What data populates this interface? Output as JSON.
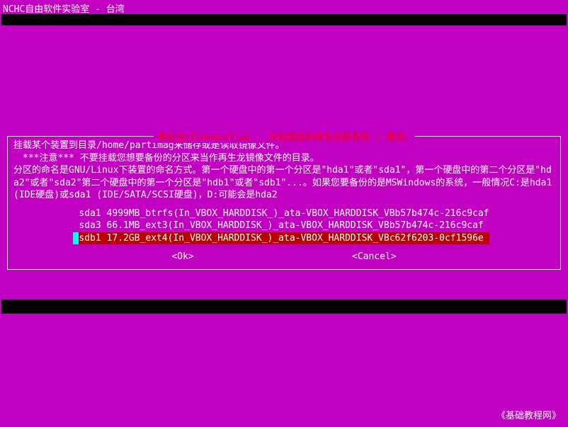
{
  "titlebar": {
    "text": "NCHC自由软件实验室 - 台湾"
  },
  "dialog": {
    "title": "再生龙(Clonezilla) - 开放原始码再生还原系统 | 模式:",
    "body": "挂载某个装置到目录/home/partimag来储存或是读取镜像文件。\n　***注意*** 不要挂载您想要备份的分区来当作再生龙镜像文件的目录。\n分区的命名是GNU/Linux下装置的命名方式。第一个硬盘中的第一个分区是\"hda1\"或者\"sda1\"，第一个硬盘中的第二个分区是\"hda2\"或者\"sda2\"第二个硬盘中的第一个分区是\"hdb1\"或者\"sdb1\"...。如果您要备份的是MSWindows的系统，一般情况C:是hda1 (IDE硬盘)或sda1 (IDE/SATA/SCSI硬盘)，D:可能会是hda2",
    "partitions": [
      {
        "text": "sda1 4999MB_btrfs(In_VBOX_HARDDISK_)_ata-VBOX_HARDDISK_VBb57b474c-216c9caf",
        "selected": false
      },
      {
        "text": "sda3 66.1MB_ext3(In_VBOX_HARDDISK_)_ata-VBOX_HARDDISK_VBb57b474c-216c9caf ",
        "selected": false
      },
      {
        "text": "sdb1 17.2GB_ext4(In_VBOX_HARDDISK_)_ata-VBOX_HARDDISK_VBc62f6203-0cf1596e ",
        "selected": true
      }
    ],
    "buttons": {
      "ok": "<Ok>",
      "cancel": "<Cancel>"
    }
  },
  "footer": {
    "credit": "《基础教程网》"
  }
}
